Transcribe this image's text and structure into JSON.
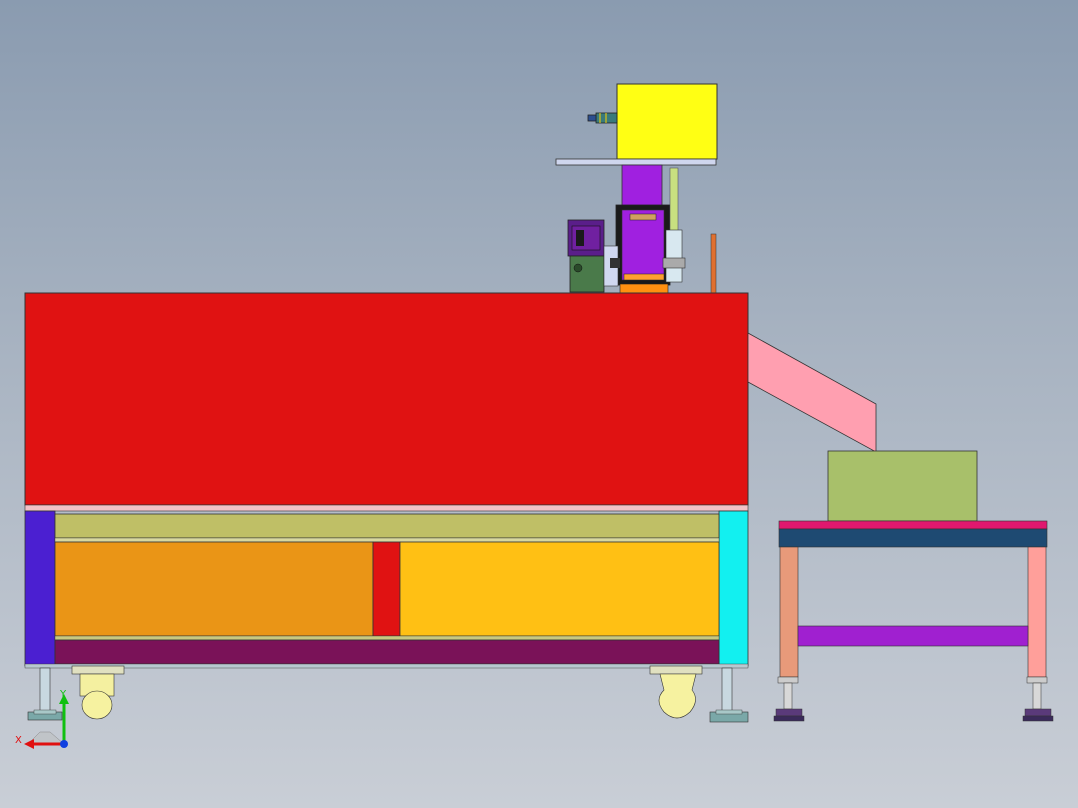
{
  "viewport": {
    "background_top": "#8a9bb0",
    "background_bottom": "#c9ced6"
  },
  "triad": {
    "x_label": "X",
    "y_label": "Y",
    "x_color": "#e01010",
    "y_color": "#10c010",
    "z_color": "#1040e0"
  },
  "colors": {
    "cabinet_top": "#e01212",
    "cabinet_left_post": "#4b1fd1",
    "cabinet_right_post": "#12f0f0",
    "rail": "#bfbf66",
    "panel_left": "#ea9516",
    "panel_right": "#ffc014",
    "divider": "#e01212",
    "base_beam": "#7a1258",
    "chute": "#ff9fb0",
    "bin": "#a8c06a",
    "table_top": "#1e4a72",
    "table_edge": "#e0186e",
    "table_leg": "#e89a7a",
    "table_crossbar": "#a020d0",
    "hopper": "#ffff14",
    "column": "#a020e0",
    "motor": "#7020a0"
  }
}
